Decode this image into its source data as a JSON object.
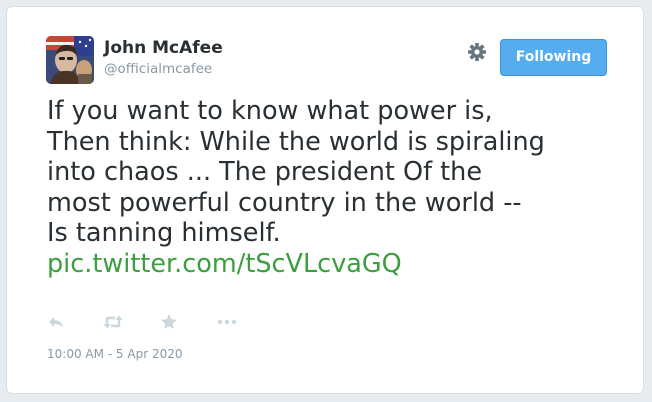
{
  "user": {
    "display_name": "John McAfee",
    "handle": "@officialmcafee"
  },
  "header": {
    "follow_button_label": "Following",
    "settings_icon": "gear-icon"
  },
  "tweet": {
    "lines": [
      "If you want to know what power is,",
      "Then think: While the world is spiraling",
      "into chaos ... The president Of the",
      "most powerful country in the world --",
      "Is tanning himself."
    ],
    "link": "pic.twitter.com/tScVLcvaGQ",
    "timestamp": "10:00 AM - 5 Apr 2020"
  },
  "actions": [
    "reply-icon",
    "retweet-icon",
    "favorite-icon",
    "more-icon"
  ],
  "colors": {
    "text": "#292f33",
    "muted": "#8899a6",
    "link": "#3b9f3f",
    "button": "#55acee",
    "action_icons": "#ccd6dd"
  }
}
